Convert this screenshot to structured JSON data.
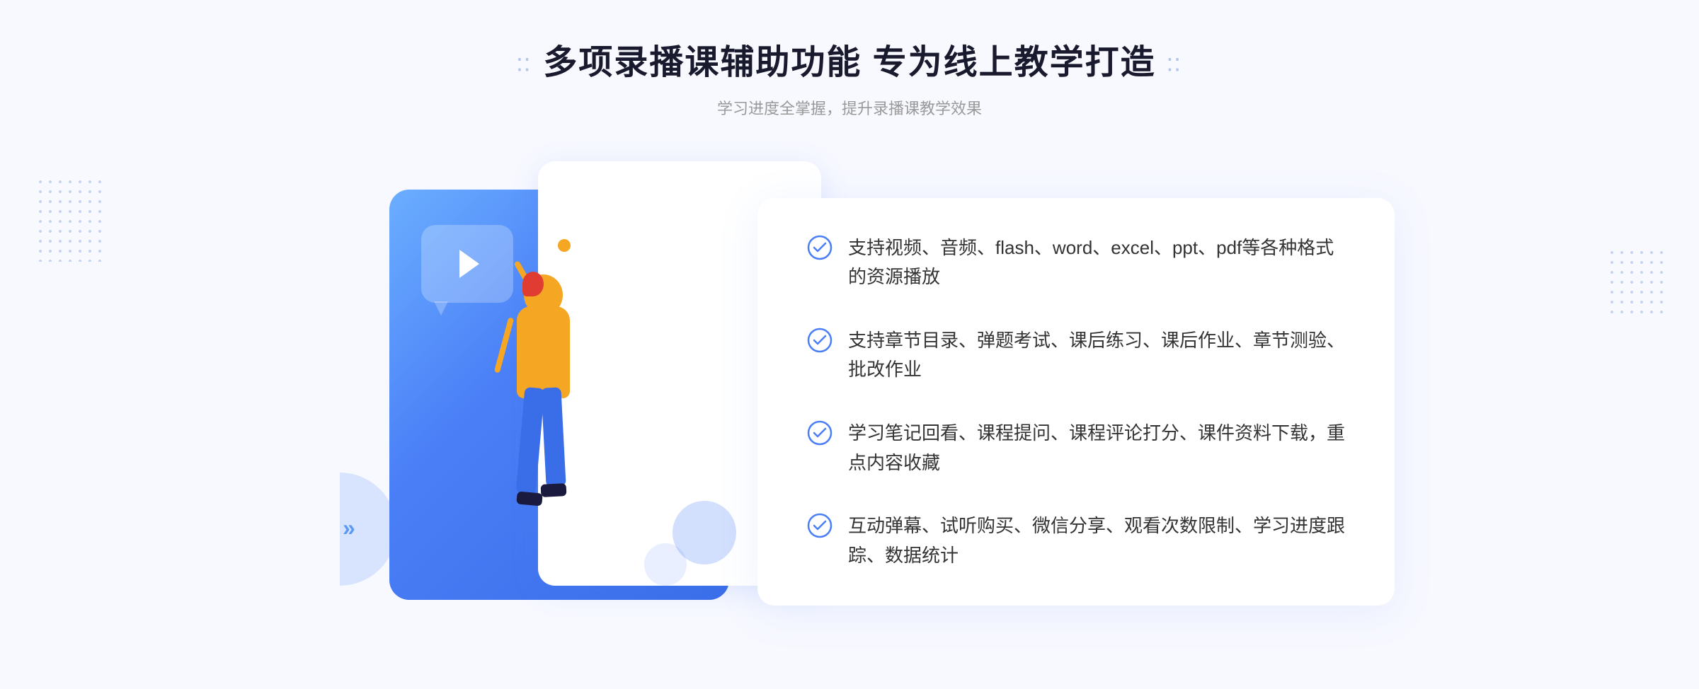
{
  "header": {
    "title": "多项录播课辅助功能 专为线上教学打造",
    "subtitle": "学习进度全掌握，提升录播课教学效果",
    "deco_left": "⁚⁚",
    "deco_right": "⁚⁚"
  },
  "features": [
    {
      "id": 1,
      "text": "支持视频、音频、flash、word、excel、ppt、pdf等各种格式的资源播放"
    },
    {
      "id": 2,
      "text": "支持章节目录、弹题考试、课后练习、课后作业、章节测验、批改作业"
    },
    {
      "id": 3,
      "text": "学习笔记回看、课程提问、课程评论打分、课件资料下载，重点内容收藏"
    },
    {
      "id": 4,
      "text": "互动弹幕、试听购买、微信分享、观看次数限制、学习进度跟踪、数据统计"
    }
  ],
  "colors": {
    "primary": "#4a7ff7",
    "title": "#1a1a2e",
    "subtitle": "#999999",
    "feature_text": "#333333",
    "check_color": "#4a7ff7",
    "bg": "#f8f9ff"
  },
  "left_arrow": "»",
  "play_icon": "▶"
}
